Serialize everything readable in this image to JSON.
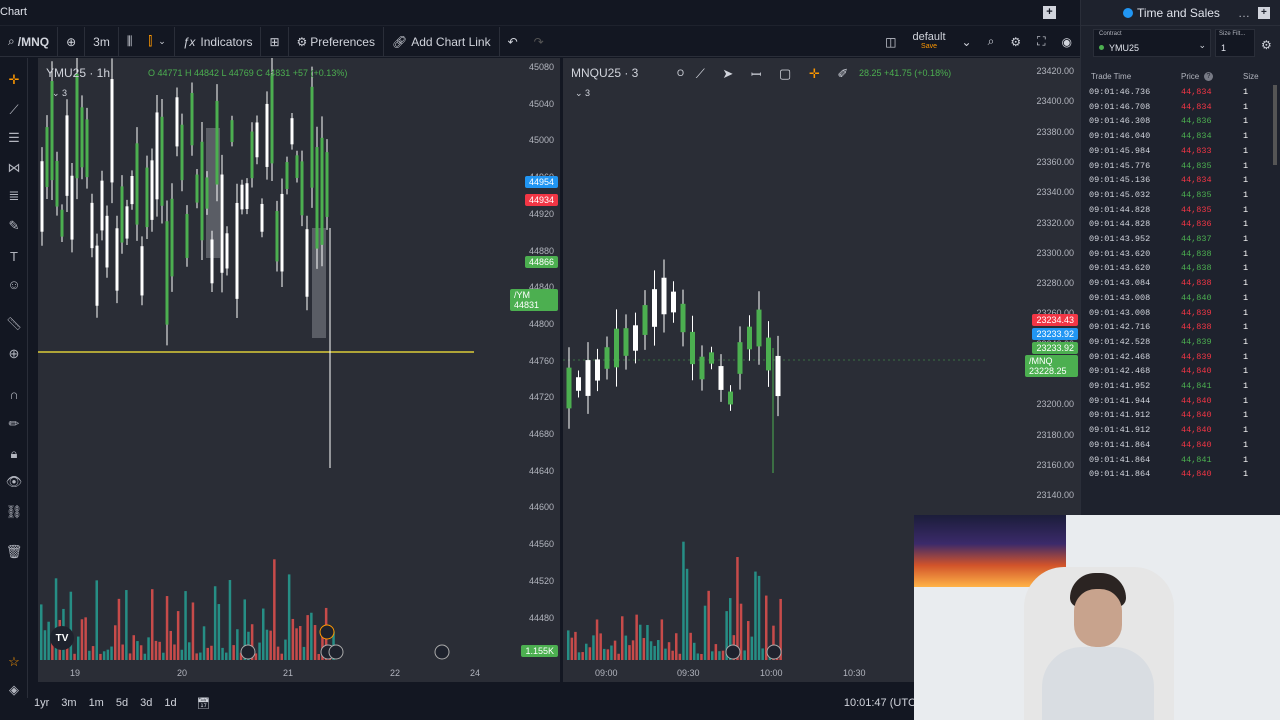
{
  "app": {
    "title": "Chart"
  },
  "toolbar": {
    "symbol": "/MNQ",
    "interval": "3m",
    "indicators_label": "Indicators",
    "preferences_label": "Preferences",
    "add_chart_link_label": "Add Chart Link",
    "layout_name": "default",
    "layout_save": "Save"
  },
  "left_pane": {
    "label": "YMU25 · 1h",
    "ohlc": "O 44771  H 44842  L 44769  C 44831  +57 (+0.13%)",
    "sub_count": "3",
    "price_ticks": [
      "45080",
      "45040",
      "45000",
      "44960",
      "44920",
      "44880",
      "44840",
      "44800",
      "44760",
      "44720",
      "44680",
      "44640",
      "44600",
      "44560",
      "44520",
      "44480"
    ],
    "badges": [
      {
        "text": "44954",
        "color": "#2196f3"
      },
      {
        "text": "44934",
        "color": "#f23645"
      },
      {
        "text": "44866",
        "color": "#4caf50"
      },
      {
        "text": "/YM  44831",
        "color": "#4caf50"
      },
      {
        "text": "1.155K",
        "color": "#4caf50"
      }
    ],
    "time_ticks": [
      "19",
      "20",
      "21",
      "22",
      "24"
    ]
  },
  "right_pane": {
    "label": "MNQU25 · 3",
    "ohlc_prefix": "O",
    "ohlc_tail": "28.25  +41.75 (+0.18%)",
    "sub_count": "3",
    "price_ticks": [
      "23420.00",
      "23400.00",
      "23380.00",
      "23360.00",
      "23340.00",
      "23320.00",
      "23300.00",
      "23280.00",
      "23260.00",
      "23240.00",
      "23220.00",
      "23200.00",
      "23180.00",
      "23160.00",
      "23140.00"
    ],
    "badges": [
      {
        "text": "23234.43",
        "color": "#f23645"
      },
      {
        "text": "23233.92",
        "color": "#2196f3"
      },
      {
        "text": "23233.92",
        "color": "#4caf50"
      },
      {
        "text": "/MNQ  23228.25",
        "color": "#4caf50"
      }
    ],
    "time_ticks": [
      "09:00",
      "09:30",
      "10:00",
      "10:30"
    ]
  },
  "bottom": {
    "ranges": [
      "1yr",
      "3m",
      "1m",
      "5d",
      "3d",
      "1d"
    ],
    "clock": "10:01:47 (UTC"
  },
  "time_and_sales": {
    "title": "Time and Sales",
    "contract_label": "Contract",
    "contract": "YMU25",
    "size_filter_label": "Size Filt...",
    "size_filter": "1",
    "columns": [
      "Trade Time",
      "Price",
      "Size"
    ],
    "rows": [
      {
        "time": "09:01:46.736",
        "price": "44,834",
        "size": "1",
        "side": "sell"
      },
      {
        "time": "09:01:46.708",
        "price": "44,834",
        "size": "1",
        "side": "sell"
      },
      {
        "time": "09:01:46.308",
        "price": "44,836",
        "size": "1",
        "side": "buy"
      },
      {
        "time": "09:01:46.040",
        "price": "44,834",
        "size": "1",
        "side": "buy"
      },
      {
        "time": "09:01:45.984",
        "price": "44,833",
        "size": "1",
        "side": "sell"
      },
      {
        "time": "09:01:45.776",
        "price": "44,835",
        "size": "1",
        "side": "buy"
      },
      {
        "time": "09:01:45.136",
        "price": "44,834",
        "size": "1",
        "side": "sell"
      },
      {
        "time": "09:01:45.032",
        "price": "44,835",
        "size": "1",
        "side": "buy"
      },
      {
        "time": "09:01:44.828",
        "price": "44,835",
        "size": "1",
        "side": "sell"
      },
      {
        "time": "09:01:44.828",
        "price": "44,836",
        "size": "1",
        "side": "sell"
      },
      {
        "time": "09:01:43.952",
        "price": "44,837",
        "size": "1",
        "side": "buy"
      },
      {
        "time": "09:01:43.620",
        "price": "44,838",
        "size": "1",
        "side": "buy"
      },
      {
        "time": "09:01:43.620",
        "price": "44,838",
        "size": "1",
        "side": "buy"
      },
      {
        "time": "09:01:43.084",
        "price": "44,838",
        "size": "1",
        "side": "sell"
      },
      {
        "time": "09:01:43.008",
        "price": "44,840",
        "size": "1",
        "side": "buy"
      },
      {
        "time": "09:01:43.008",
        "price": "44,839",
        "size": "1",
        "side": "sell"
      },
      {
        "time": "09:01:42.716",
        "price": "44,838",
        "size": "1",
        "side": "sell"
      },
      {
        "time": "09:01:42.528",
        "price": "44,839",
        "size": "1",
        "side": "buy"
      },
      {
        "time": "09:01:42.468",
        "price": "44,839",
        "size": "1",
        "side": "sell"
      },
      {
        "time": "09:01:42.468",
        "price": "44,840",
        "size": "1",
        "side": "sell"
      },
      {
        "time": "09:01:41.952",
        "price": "44,841",
        "size": "1",
        "side": "buy"
      },
      {
        "time": "09:01:41.944",
        "price": "44,840",
        "size": "1",
        "side": "sell"
      },
      {
        "time": "09:01:41.912",
        "price": "44,840",
        "size": "1",
        "side": "sell"
      },
      {
        "time": "09:01:41.912",
        "price": "44,840",
        "size": "1",
        "side": "sell"
      },
      {
        "time": "09:01:41.864",
        "price": "44,840",
        "size": "1",
        "side": "sell"
      },
      {
        "time": "09:01:41.864",
        "price": "44,841",
        "size": "1",
        "side": "buy"
      },
      {
        "time": "09:01:41.864",
        "price": "44,840",
        "size": "1",
        "side": "sell"
      }
    ]
  },
  "colors": {
    "buy": "#4caf50",
    "sell": "#f23645",
    "bg": "#131722",
    "pane": "#2a2d36"
  }
}
